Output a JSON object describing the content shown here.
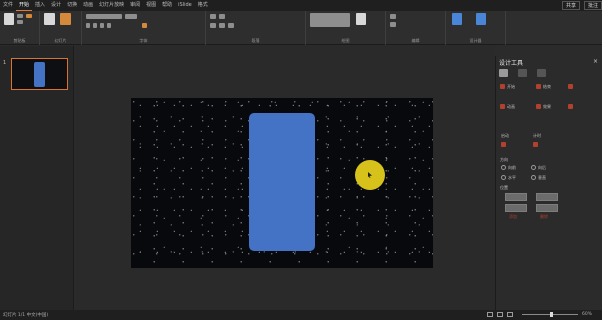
{
  "tabbar": {
    "tabs": [
      "文件",
      "开始",
      "插入",
      "设计",
      "切换",
      "动画",
      "幻灯片放映",
      "审阅",
      "视图",
      "帮助",
      "iSlide",
      "格式"
    ],
    "active_index": 1,
    "share_label": "共享",
    "comments_label": "批注"
  },
  "ribbon": {
    "groups": [
      "剪贴板",
      "幻灯片",
      "字体",
      "段落",
      "绘图",
      "编辑",
      "设计器"
    ]
  },
  "thumbs": {
    "slide_number": "1"
  },
  "format_panel": {
    "title": "设计工具",
    "close": "×",
    "options": [
      "开始",
      "结束",
      "动画",
      "效果",
      "启动",
      "计时"
    ],
    "section_label": "方向",
    "radios": [
      "向前",
      "向后",
      "水平",
      "垂直"
    ],
    "position_label": "位置",
    "link_labels": [
      "添加",
      "删除"
    ]
  },
  "statusbar": {
    "left_text": "幻灯片 1/1  中文(中国)",
    "zoom": "60%"
  },
  "colors": {
    "shape_fill": "#4472c4",
    "cursor_highlight": "#d6c21a",
    "selection_border": "#d9742e"
  }
}
